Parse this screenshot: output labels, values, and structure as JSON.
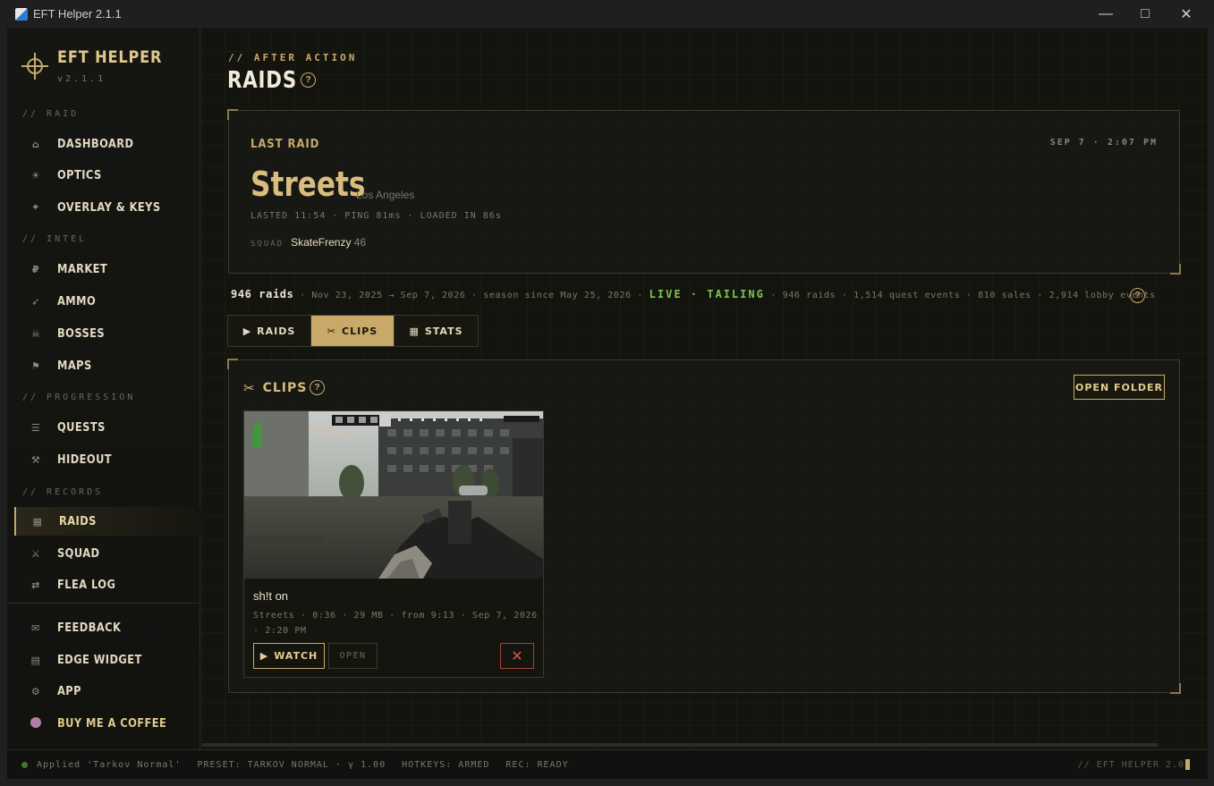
{
  "window": {
    "title": "EFT Helper 2.1.1"
  },
  "brand": {
    "name": "EFT HELPER",
    "version": "v2.1.1"
  },
  "sidebar": {
    "sections": {
      "raid": "// RAID",
      "intel": "// INTEL",
      "progression": "// PROGRESSION",
      "records": "// RECORDS"
    },
    "items": {
      "dashboard": {
        "label": "DASHBOARD",
        "icon": "⌂"
      },
      "optics": {
        "label": "OPTICS",
        "icon": "☀"
      },
      "overlay": {
        "label": "OVERLAY & KEYS",
        "icon": "⌖"
      },
      "market": {
        "label": "MARKET",
        "icon": "₽"
      },
      "ammo": {
        "label": "AMMO",
        "icon": "➶"
      },
      "bosses": {
        "label": "BOSSES",
        "icon": "☠"
      },
      "maps": {
        "label": "MAPS",
        "icon": "⚑"
      },
      "quests": {
        "label": "QUESTS",
        "icon": "☰"
      },
      "hideout": {
        "label": "HIDEOUT",
        "icon": "⚒"
      },
      "raids": {
        "label": "RAIDS",
        "icon": "▦"
      },
      "squad": {
        "label": "SQUAD",
        "icon": "⚔"
      },
      "flealog": {
        "label": "FLEA LOG",
        "icon": "⇄"
      },
      "feedback": {
        "label": "FEEDBACK",
        "icon": "✉"
      },
      "edgewidget": {
        "label": "EDGE WIDGET",
        "icon": "▤"
      },
      "app": {
        "label": "APP",
        "icon": "⚙"
      },
      "coffee": {
        "label": "BUY ME A COFFEE",
        "icon": "coffee-icon"
      }
    }
  },
  "header": {
    "crumb": "// AFTER ACTION",
    "title": "RAIDS",
    "help": "?"
  },
  "last_raid": {
    "label": "LAST RAID",
    "date": "SEP 7 · 2:07 PM",
    "map": "Streets",
    "city": "Los Angeles",
    "meta": "LASTED 11:54 · PING 81ms · LOADED IN 86s",
    "squad_key": "SQUAD",
    "squad_name": "SkateFrenzy",
    "squad_level": "46"
  },
  "stats": {
    "raids_count": "946 raids",
    "range": "· Nov 23, 2025 → Sep 7, 2026 · season since May 25, 2026 ·",
    "live": "LIVE · TAILING",
    "details": "· 946 raids · 1,514 quest events · 810 sales · 2,914 lobby events"
  },
  "tabs": [
    {
      "label": "RAIDS",
      "icon": "▶"
    },
    {
      "label": "CLIPS",
      "icon": "✂"
    },
    {
      "label": "STATS",
      "icon": "▦"
    }
  ],
  "clips": {
    "title": "CLIPS",
    "open_folder": "OPEN FOLDER",
    "items": [
      {
        "title": "sh!t on",
        "meta": "Streets · 0:36 · 29 MB · from 9:13 · Sep 7, 2026 · 2:20 PM",
        "watch": "WATCH",
        "open": "OPEN",
        "delete": "✕"
      }
    ]
  },
  "statusbar": {
    "applied": "Applied 'Tarkov Normal'",
    "preset": "PRESET: TARKOV NORMAL · γ 1.00",
    "hotkeys": "HOTKEYS: ARMED",
    "rec": "REC: READY",
    "right": "// EFT HELPER 2.0"
  }
}
